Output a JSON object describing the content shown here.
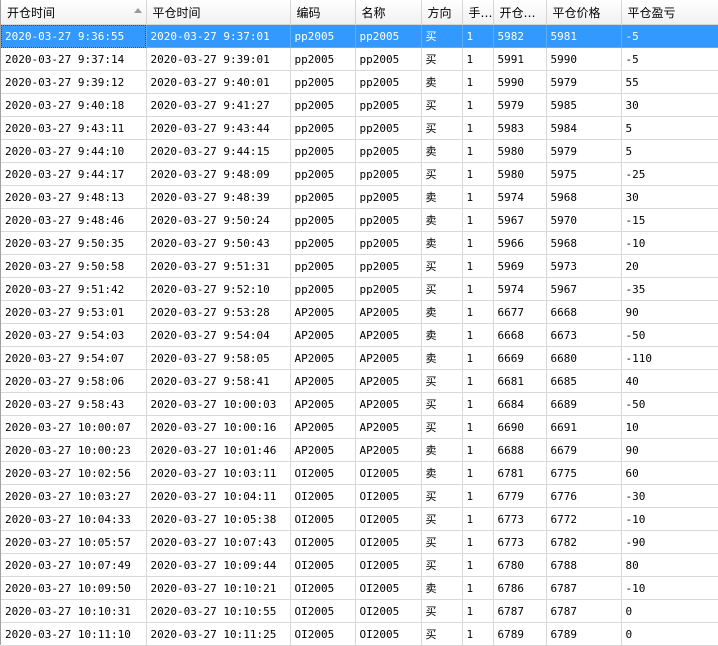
{
  "columns": [
    "开仓时间",
    "平仓时间",
    "编码",
    "名称",
    "方向",
    "手数",
    "开仓价格",
    "平仓价格",
    "平仓盈亏"
  ],
  "columns_display": [
    "开仓时间",
    "平仓时间",
    "编码",
    "名称",
    "方向",
    "手…",
    "开仓…",
    "平仓价格",
    "平仓盈亏"
  ],
  "selected_row": 0,
  "colors": {
    "selection": "#3399ff",
    "grid_line": "#d8d8d8"
  },
  "rows": [
    [
      "2020-03-27  9:36:55",
      "2020-03-27  9:37:01",
      "pp2005",
      "pp2005",
      "买",
      "1",
      "5982",
      "5981",
      "-5"
    ],
    [
      "2020-03-27  9:37:14",
      "2020-03-27  9:39:01",
      "pp2005",
      "pp2005",
      "买",
      "1",
      "5991",
      "5990",
      "-5"
    ],
    [
      "2020-03-27  9:39:12",
      "2020-03-27  9:40:01",
      "pp2005",
      "pp2005",
      "卖",
      "1",
      "5990",
      "5979",
      "55"
    ],
    [
      "2020-03-27  9:40:18",
      "2020-03-27  9:41:27",
      "pp2005",
      "pp2005",
      "买",
      "1",
      "5979",
      "5985",
      "30"
    ],
    [
      "2020-03-27  9:43:11",
      "2020-03-27  9:43:44",
      "pp2005",
      "pp2005",
      "买",
      "1",
      "5983",
      "5984",
      "5"
    ],
    [
      "2020-03-27  9:44:10",
      "2020-03-27  9:44:15",
      "pp2005",
      "pp2005",
      "卖",
      "1",
      "5980",
      "5979",
      "5"
    ],
    [
      "2020-03-27  9:44:17",
      "2020-03-27  9:48:09",
      "pp2005",
      "pp2005",
      "买",
      "1",
      "5980",
      "5975",
      "-25"
    ],
    [
      "2020-03-27  9:48:13",
      "2020-03-27  9:48:39",
      "pp2005",
      "pp2005",
      "卖",
      "1",
      "5974",
      "5968",
      "30"
    ],
    [
      "2020-03-27  9:48:46",
      "2020-03-27  9:50:24",
      "pp2005",
      "pp2005",
      "卖",
      "1",
      "5967",
      "5970",
      "-15"
    ],
    [
      "2020-03-27  9:50:35",
      "2020-03-27  9:50:43",
      "pp2005",
      "pp2005",
      "卖",
      "1",
      "5966",
      "5968",
      "-10"
    ],
    [
      "2020-03-27  9:50:58",
      "2020-03-27  9:51:31",
      "pp2005",
      "pp2005",
      "买",
      "1",
      "5969",
      "5973",
      "20"
    ],
    [
      "2020-03-27  9:51:42",
      "2020-03-27  9:52:10",
      "pp2005",
      "pp2005",
      "买",
      "1",
      "5974",
      "5967",
      "-35"
    ],
    [
      "2020-03-27  9:53:01",
      "2020-03-27  9:53:28",
      "AP2005",
      "AP2005",
      "卖",
      "1",
      "6677",
      "6668",
      "90"
    ],
    [
      "2020-03-27  9:54:03",
      "2020-03-27  9:54:04",
      "AP2005",
      "AP2005",
      "卖",
      "1",
      "6668",
      "6673",
      "-50"
    ],
    [
      "2020-03-27  9:54:07",
      "2020-03-27  9:58:05",
      "AP2005",
      "AP2005",
      "卖",
      "1",
      "6669",
      "6680",
      "-110"
    ],
    [
      "2020-03-27  9:58:06",
      "2020-03-27  9:58:41",
      "AP2005",
      "AP2005",
      "买",
      "1",
      "6681",
      "6685",
      "40"
    ],
    [
      "2020-03-27  9:58:43",
      "2020-03-27  10:00:03",
      "AP2005",
      "AP2005",
      "买",
      "1",
      "6684",
      "6689",
      "-50"
    ],
    [
      "2020-03-27  10:00:07",
      "2020-03-27  10:00:16",
      "AP2005",
      "AP2005",
      "买",
      "1",
      "6690",
      "6691",
      "10"
    ],
    [
      "2020-03-27  10:00:23",
      "2020-03-27  10:01:46",
      "AP2005",
      "AP2005",
      "卖",
      "1",
      "6688",
      "6679",
      "90"
    ],
    [
      "2020-03-27  10:02:56",
      "2020-03-27  10:03:11",
      "OI2005",
      "OI2005",
      "卖",
      "1",
      "6781",
      "6775",
      "60"
    ],
    [
      "2020-03-27  10:03:27",
      "2020-03-27  10:04:11",
      "OI2005",
      "OI2005",
      "买",
      "1",
      "6779",
      "6776",
      "-30"
    ],
    [
      "2020-03-27  10:04:33",
      "2020-03-27  10:05:38",
      "OI2005",
      "OI2005",
      "买",
      "1",
      "6773",
      "6772",
      "-10"
    ],
    [
      "2020-03-27  10:05:57",
      "2020-03-27  10:07:43",
      "OI2005",
      "OI2005",
      "买",
      "1",
      "6773",
      "6782",
      "-90"
    ],
    [
      "2020-03-27  10:07:49",
      "2020-03-27  10:09:44",
      "OI2005",
      "OI2005",
      "买",
      "1",
      "6780",
      "6788",
      "80"
    ],
    [
      "2020-03-27  10:09:50",
      "2020-03-27  10:10:21",
      "OI2005",
      "OI2005",
      "卖",
      "1",
      "6786",
      "6787",
      "-10"
    ],
    [
      "2020-03-27  10:10:31",
      "2020-03-27  10:10:55",
      "OI2005",
      "OI2005",
      "买",
      "1",
      "6787",
      "6787",
      "0"
    ],
    [
      "2020-03-27  10:11:10",
      "2020-03-27  10:11:25",
      "OI2005",
      "OI2005",
      "买",
      "1",
      "6789",
      "6789",
      "0"
    ]
  ]
}
